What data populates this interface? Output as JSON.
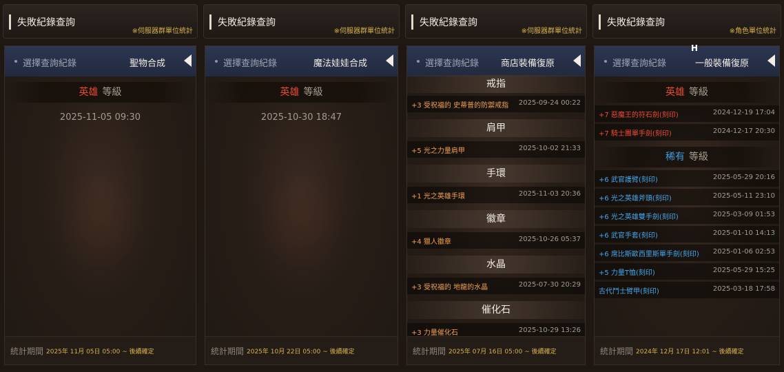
{
  "common": {
    "window_title": "失敗紀錄查詢",
    "selector_label": "選擇查詢紀錄",
    "footer_label": "統計期間"
  },
  "panels": [
    {
      "scope": "※伺服器群單位統計",
      "selected": "聖物合成",
      "grade": {
        "name": "英雄",
        "suffix": "等級"
      },
      "date": "2025-11-05 09:30",
      "footer": "2025年 11月 05日 05:00 ~ 後續確定"
    },
    {
      "scope": "※伺服器群單位統計",
      "selected": "魔法娃娃合成",
      "grade": {
        "name": "英雄",
        "suffix": "等級"
      },
      "date": "2025-10-30 18:47",
      "footer": "2025年 10月 22日 05:00 ~ 後續確定"
    },
    {
      "scope": "※伺服器群單位統計",
      "selected": "商店裝備復原",
      "categories": [
        {
          "name": "戒指",
          "items": [
            {
              "name": "+3 受祝福的 史蒂普的防禦戒指",
              "time": "2025-09-24 00:22"
            }
          ]
        },
        {
          "name": "肩甲",
          "items": [
            {
              "name": "+5 光之力量肩甲",
              "time": "2025-10-02 21:33"
            }
          ]
        },
        {
          "name": "手環",
          "items": [
            {
              "name": "+1 光之英雄手環",
              "time": "2025-11-03 20:36"
            }
          ]
        },
        {
          "name": "徽章",
          "items": [
            {
              "name": "+4 獵人徽章",
              "time": "2025-10-26 05:37"
            }
          ]
        },
        {
          "name": "水晶",
          "items": [
            {
              "name": "+3 受祝福的 地龍的水晶",
              "time": "2025-07-30 20:29"
            }
          ]
        },
        {
          "name": "催化石",
          "items": [
            {
              "name": "+3 力量催化石",
              "time": "2025-10-29 13:26"
            }
          ]
        }
      ],
      "footer": "2025年 07月 16日 05:00 ~ 後續確定"
    },
    {
      "scope": "※角色單位統計",
      "selected": "一般裝備復原",
      "hero_grade": {
        "name": "英雄",
        "suffix": "等級"
      },
      "hero_items": [
        {
          "name": "+7 惡魔王的符石劍(刻印)",
          "time": "2024-12-19 17:04"
        },
        {
          "name": "+7 騎士團單手劍(刻印)",
          "time": "2024-12-17 20:30"
        }
      ],
      "rare_grade": {
        "name": "稀有",
        "suffix": "等級"
      },
      "rare_items": [
        {
          "name": "+6 武官護臂(刻印)",
          "time": "2025-05-29 20:16"
        },
        {
          "name": "+6 光之英雄斧頭(刻印)",
          "time": "2025-05-11 23:10"
        },
        {
          "name": "+6 光之英雄雙手劍(刻印)",
          "time": "2025-03-09 01:53"
        },
        {
          "name": "+6 武官手套(刻印)",
          "time": "2025-01-10 14:13"
        },
        {
          "name": "+6 席比斯歐西里斯單手劍(刻印)",
          "time": "2025-01-06 02:53"
        },
        {
          "name": "+5 力量T恤(刻印)",
          "time": "2025-05-29 15:25"
        },
        {
          "name": "古代鬥士臂甲(刻印)",
          "time": "2025-03-18 17:58"
        }
      ],
      "footer": "2024年 12月 17日 12:01 ~ 後續確定",
      "cursor_label": "H"
    }
  ]
}
